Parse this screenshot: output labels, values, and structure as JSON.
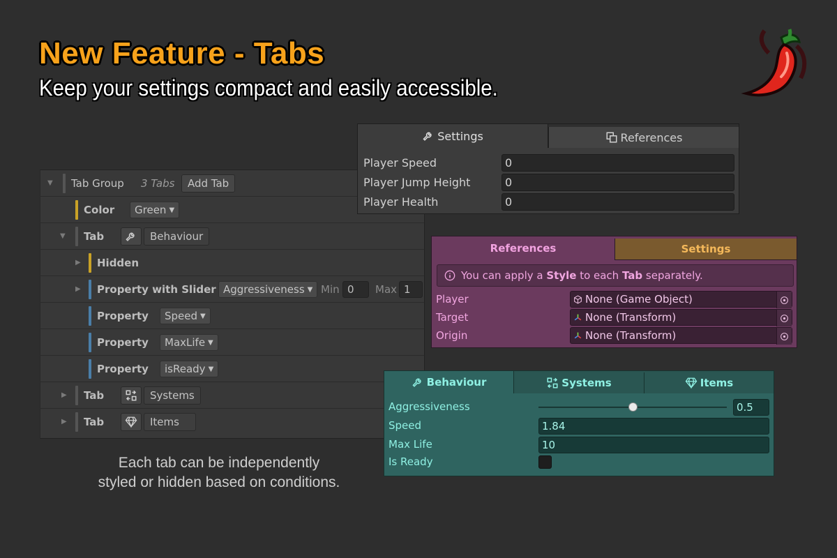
{
  "header": {
    "title": "New Feature - Tabs",
    "subtitle": "Keep your settings compact and easily accessible."
  },
  "inspector": {
    "tab_group": {
      "label": "Tab Group",
      "count": "3 Tabs",
      "add_button": "Add Tab"
    },
    "color": {
      "label": "Color",
      "value": "Green"
    },
    "tab_behaviour": {
      "label": "Tab",
      "name": "Behaviour"
    },
    "hidden": {
      "label": "Hidden"
    },
    "slider_prop": {
      "label": "Property with Slider",
      "value": "Aggressiveness",
      "min_label": "Min",
      "min_value": "0",
      "max_label": "Max",
      "max_value": "1"
    },
    "props": [
      {
        "label": "Property",
        "value": "Speed"
      },
      {
        "label": "Property",
        "value": "MaxLife"
      },
      {
        "label": "Property",
        "value": "isReady"
      }
    ],
    "tab_systems": {
      "label": "Tab",
      "name": "Systems"
    },
    "tab_items": {
      "label": "Tab",
      "name": "Items"
    },
    "accent_colors": {
      "yellow": "#c9a227",
      "blue": "#4a7ea8"
    }
  },
  "caption": {
    "line1": "Each tab can be independently",
    "line2": "styled or hidden based on conditions."
  },
  "settings_panel": {
    "tabs": [
      {
        "label": "Settings",
        "icon": "wrench-icon",
        "active": true
      },
      {
        "label": "References",
        "icon": "copy-icon",
        "active": false
      }
    ],
    "rows": [
      {
        "label": "Player Speed",
        "value": "0"
      },
      {
        "label": "Player Jump Height",
        "value": "0"
      },
      {
        "label": "Player Health",
        "value": "0"
      }
    ]
  },
  "references_panel": {
    "tabs": [
      {
        "label": "References",
        "active": true
      },
      {
        "label": "Settings",
        "active": false
      }
    ],
    "info": {
      "pre": "You can apply a ",
      "b1": "Style",
      "mid": " to each ",
      "b2": "Tab",
      "post": " separately."
    },
    "rows": [
      {
        "label": "Player",
        "value": "None (Game Object)",
        "icon": "cube-icon"
      },
      {
        "label": "Target",
        "value": "None (Transform)",
        "icon": "transform-icon"
      },
      {
        "label": "Origin",
        "value": "None (Transform)",
        "icon": "transform-icon"
      }
    ],
    "colors": {
      "bg": "#6b3a5e",
      "text": "#f1a6e0",
      "inactive_tab": "#7a5a2e"
    }
  },
  "behaviour_panel": {
    "tabs": [
      {
        "label": "Behaviour",
        "icon": "wrench-icon",
        "active": true
      },
      {
        "label": "Systems",
        "icon": "swap-icon",
        "active": false
      },
      {
        "label": "Items",
        "icon": "gem-icon",
        "active": false
      }
    ],
    "aggressiveness": {
      "label": "Aggressiveness",
      "value": "0.5",
      "fraction": 0.5
    },
    "speed": {
      "label": "Speed",
      "value": "1.84"
    },
    "max_life": {
      "label": "Max Life",
      "value": "10"
    },
    "is_ready": {
      "label": "Is Ready",
      "checked": false
    },
    "colors": {
      "bg": "#2f6460",
      "text": "#8ff0e3"
    }
  }
}
